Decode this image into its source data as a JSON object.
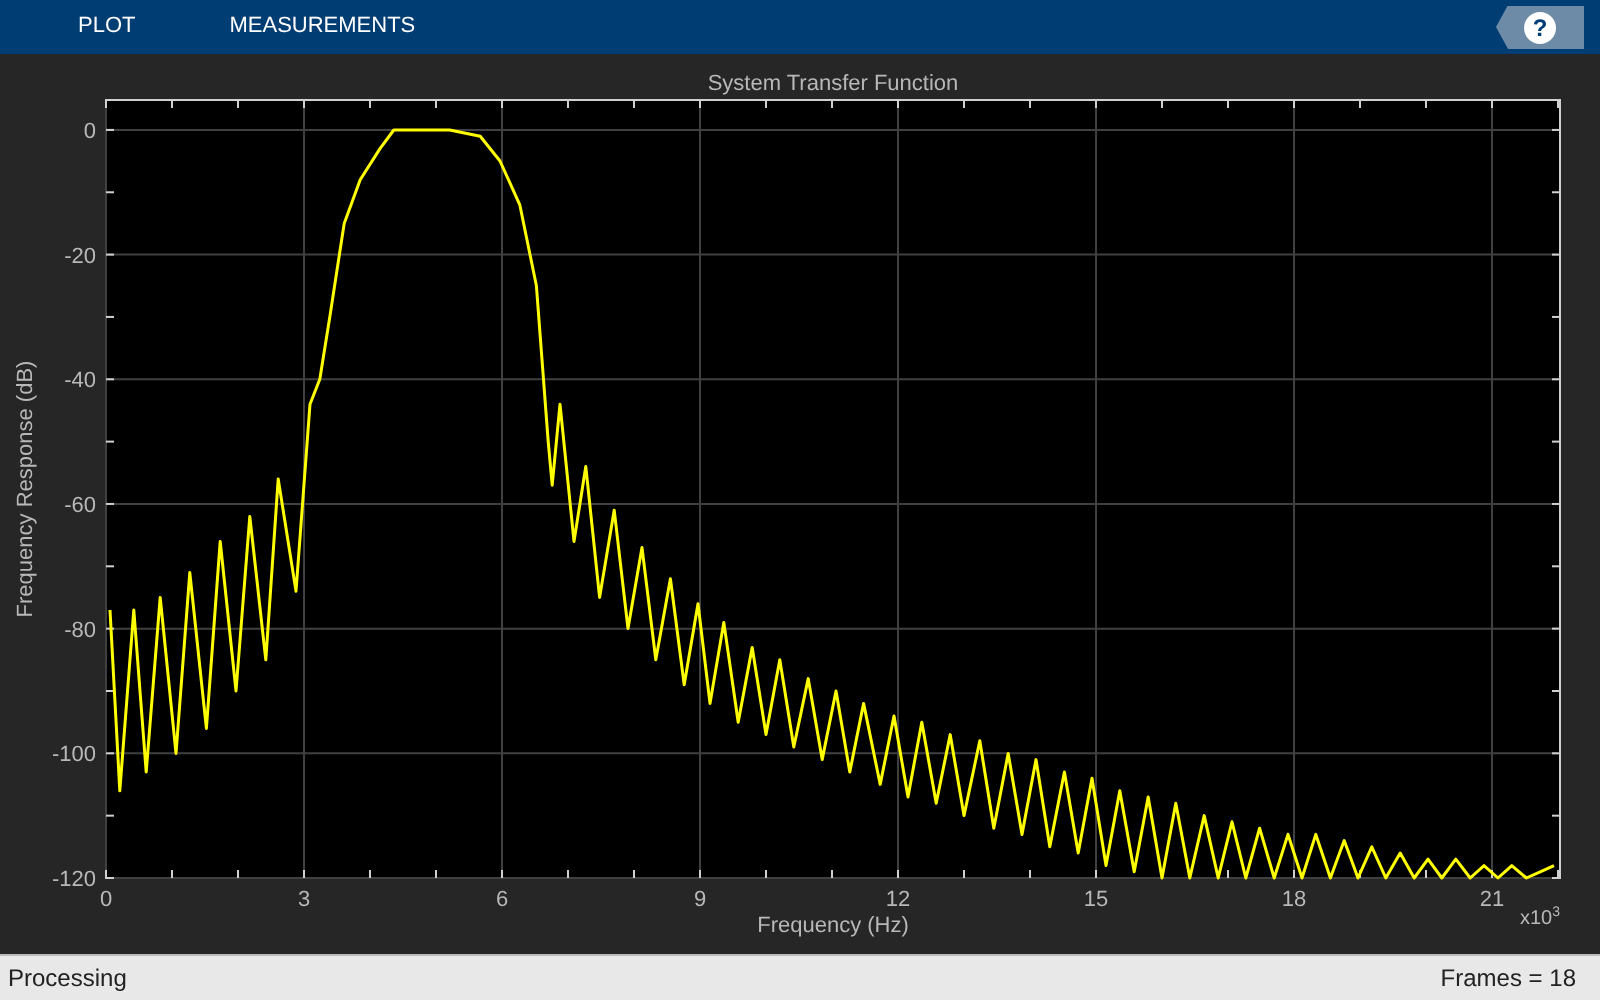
{
  "toolstrip": {
    "tabs": [
      {
        "label": "PLOT"
      },
      {
        "label": "MEASUREMENTS"
      }
    ],
    "help_button": "?"
  },
  "plot": {
    "chart_data": {
      "type": "line",
      "title": "System Transfer Function",
      "xlabel": "Frequency (Hz)",
      "ylabel": "Frequency Response (dB)",
      "xlim": [
        0,
        22.03
      ],
      "ylim": [
        -120,
        4.8
      ],
      "grid": true,
      "xticks": [
        0,
        3,
        6,
        9,
        12,
        15,
        18,
        21
      ],
      "yticks": [
        0,
        -20,
        -40,
        -60,
        -80,
        -100,
        -120
      ],
      "x": [
        0.06,
        0.21,
        0.42,
        0.61,
        0.82,
        1.06,
        1.27,
        1.52,
        1.73,
        1.97,
        2.18,
        2.42,
        2.61,
        2.88,
        3.09,
        3.24,
        3.39,
        3.61,
        3.85,
        4.15,
        4.36,
        4.76,
        5.21,
        5.67,
        5.97,
        6.27,
        6.52,
        6.7,
        6.76,
        6.88,
        7.09,
        7.27,
        7.48,
        7.7,
        7.91,
        8.12,
        8.33,
        8.55,
        8.76,
        8.97,
        9.15,
        9.36,
        9.58,
        9.79,
        10.0,
        10.21,
        10.42,
        10.64,
        10.85,
        11.06,
        11.27,
        11.48,
        11.73,
        11.94,
        12.15,
        12.36,
        12.58,
        12.79,
        13.0,
        13.24,
        13.45,
        13.67,
        13.88,
        14.09,
        14.3,
        14.52,
        14.73,
        14.94,
        15.15,
        15.36,
        15.58,
        15.79,
        16.0,
        16.21,
        16.42,
        16.64,
        16.85,
        17.06,
        17.27,
        17.48,
        17.7,
        17.91,
        18.12,
        18.33,
        18.55,
        18.76,
        18.97,
        19.18,
        19.39,
        19.61,
        19.82,
        20.03,
        20.24,
        20.45,
        20.67,
        20.88,
        21.09,
        21.3,
        21.52,
        21.73,
        21.94
      ],
      "series": [
        {
          "color": "#ffff00",
          "values": [
            -77,
            -106,
            -77,
            -103,
            -75,
            -100,
            -71,
            -96,
            -66,
            -90,
            -62,
            -85,
            -56,
            -74,
            -44,
            -40,
            -30,
            -15,
            -8,
            -3,
            0,
            0,
            0,
            -1,
            -5,
            -12,
            -25,
            -50,
            -57,
            -44,
            -66,
            -54,
            -75,
            -61,
            -80,
            -67,
            -85,
            -72,
            -89,
            -76,
            -92,
            -79,
            -95,
            -83,
            -97,
            -85,
            -99,
            -88,
            -101,
            -90,
            -103,
            -92,
            -105,
            -94,
            -107,
            -95,
            -108,
            -97,
            -110,
            -98,
            -112,
            -100,
            -113,
            -101,
            -115,
            -103,
            -116,
            -104,
            -118,
            -106,
            -119,
            -107,
            -120,
            -108,
            -120,
            -110,
            -120,
            -111,
            -120,
            -112,
            -120,
            -113,
            -120,
            -113,
            -120,
            -114,
            -120,
            -115,
            -120,
            -116,
            -120,
            -117,
            -120,
            -117,
            -120,
            -118,
            -120,
            -118,
            -120,
            -119,
            -118
          ]
        }
      ]
    },
    "x_exponent": "x10$^{3}$"
  },
  "status_bar": {
    "left": "Processing",
    "right": "Frames = 18"
  }
}
